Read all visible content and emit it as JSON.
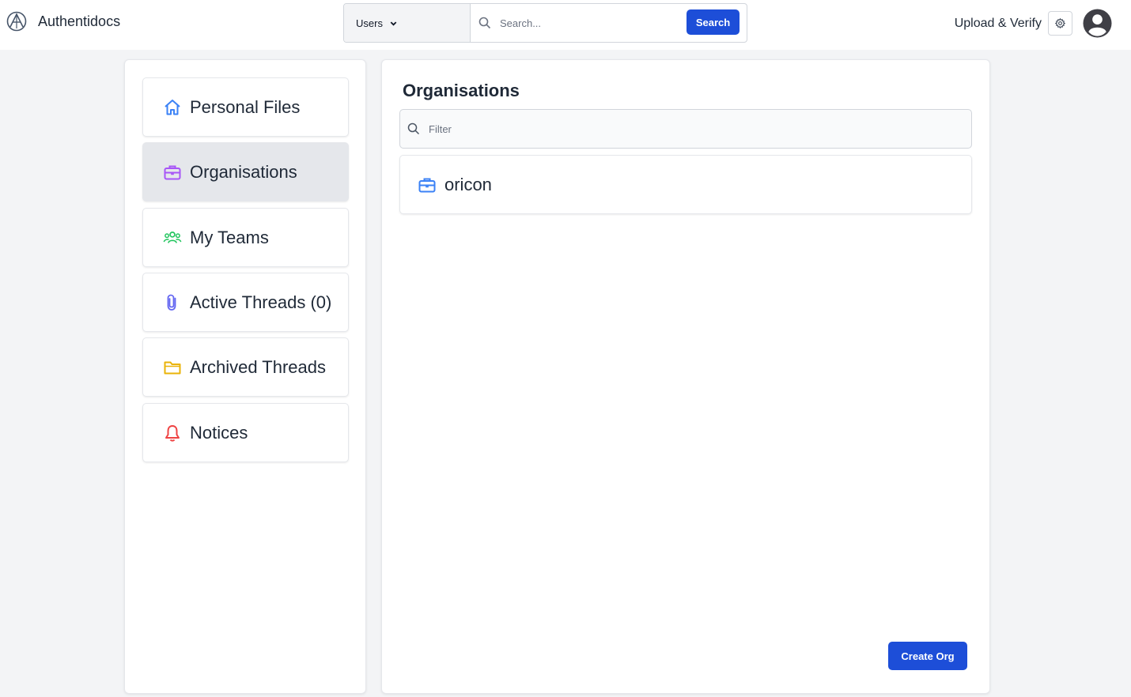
{
  "header": {
    "app_name": "Authentidocs",
    "scope_select": {
      "selected": "Users"
    },
    "search": {
      "placeholder": "Search...",
      "button_label": "Search"
    },
    "upload_link": "Upload & Verify"
  },
  "sidebar": {
    "items": [
      {
        "label": "Personal Files",
        "icon": "home-icon",
        "color": "#3b82f6",
        "active": false
      },
      {
        "label": "Organisations",
        "icon": "briefcase-icon",
        "color": "#a855f7",
        "active": true
      },
      {
        "label": "My Teams",
        "icon": "users-icon",
        "color": "#22c55e",
        "active": false
      },
      {
        "label": "Active Threads (0)",
        "icon": "paperclip-icon",
        "color": "#6366f1",
        "active": false
      },
      {
        "label": "Archived Threads",
        "icon": "folder-icon",
        "color": "#eab308",
        "active": false
      },
      {
        "label": "Notices",
        "icon": "bell-icon",
        "color": "#ef4444",
        "active": false
      }
    ]
  },
  "main": {
    "title": "Organisations",
    "filter": {
      "placeholder": "Filter"
    },
    "organisations": [
      {
        "name": "oricon",
        "icon": "briefcase-icon",
        "color": "#3b82f6"
      }
    ],
    "create_button": "Create Org"
  },
  "colors": {
    "primary": "#1d4ed8",
    "background": "#f3f4f6",
    "active_item": "#e5e7eb"
  }
}
